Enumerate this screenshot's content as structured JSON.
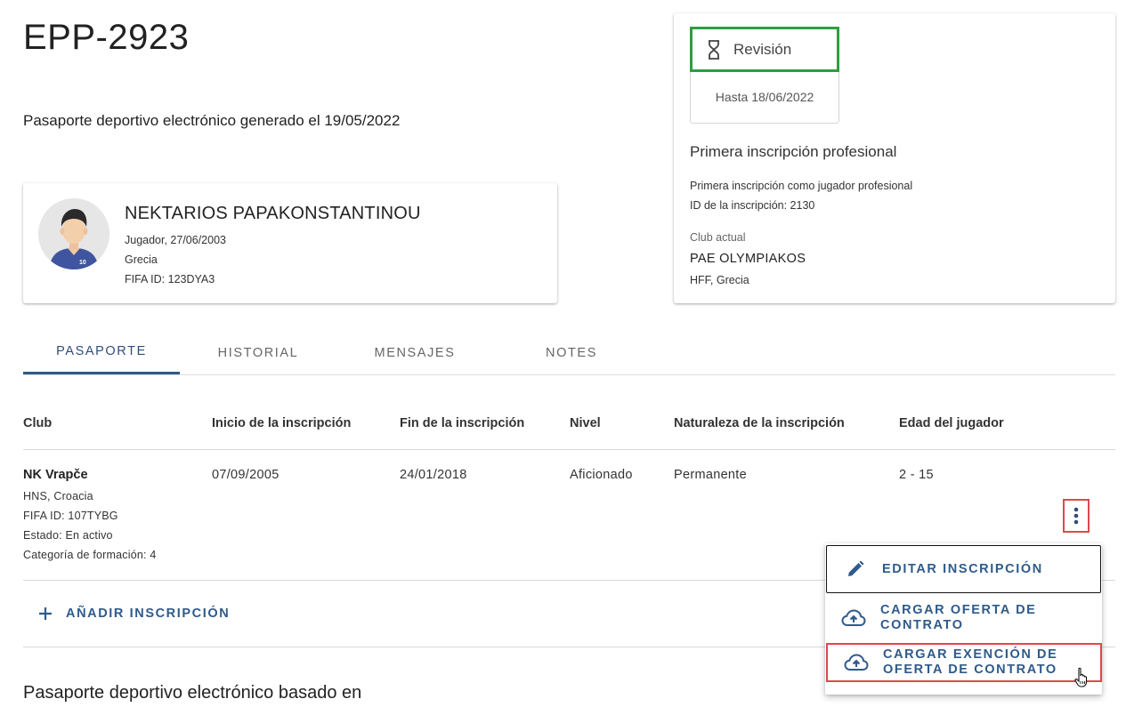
{
  "page": {
    "title": "EPP-2923",
    "subtitle": "Pasaporte deportivo electrónico generado el 19/05/2022"
  },
  "player": {
    "name": "NEKTARIOS PAPAKONSTANTINOU",
    "role_birth": "Jugador, 27/06/2003",
    "country": "Grecia",
    "fifa_id": "FIFA ID: 123DYA3",
    "jersey_number": "10"
  },
  "status": {
    "label": "Revisión",
    "until": "Hasta 18/06/2022",
    "accent_color": "#2e9e3e"
  },
  "registration": {
    "title": "Primera inscripción profesional",
    "description": "Primera inscripción como jugador profesional",
    "id": "ID de la inscripción: 2130",
    "current_club_label": "Club actual",
    "current_club_name": "PAE OLYMPIAKOS",
    "current_club_federation": "HFF, Grecia"
  },
  "tabs": [
    {
      "label": "PASAPORTE",
      "active": true
    },
    {
      "label": "HISTORIAL",
      "active": false
    },
    {
      "label": "MENSAJES",
      "active": false
    },
    {
      "label": "NOTES",
      "active": false
    }
  ],
  "table": {
    "headers": [
      "Club",
      "Inicio de la inscripción",
      "Fin de la inscripción",
      "Nivel",
      "Naturaleza de la inscripción",
      "Edad del jugador"
    ],
    "rows": [
      {
        "club_name": "NK Vrapče",
        "club_federation": "HNS, Croacia",
        "club_fifa_id": "FIFA ID: 107TYBG",
        "club_status": "Estado: En activo",
        "club_training_category": "Categoría de formación: 4",
        "start": "07/09/2005",
        "end": "24/01/2018",
        "level": "Aficionado",
        "nature": "Permanente",
        "age": "2 - 15"
      }
    ]
  },
  "actions": {
    "add_registration": "AÑADIR INSCRIPCIÓN",
    "more_icon": "more-vertical-icon"
  },
  "menu": {
    "items": [
      {
        "label": "EDITAR INSCRIPCIÓN",
        "icon": "pencil-icon"
      },
      {
        "label": "CARGAR OFERTA DE CONTRATO",
        "icon": "cloud-upload-icon"
      },
      {
        "label": "CARGAR EXENCIÓN DE OFERTA DE CONTRATO",
        "icon": "cloud-upload-icon"
      }
    ]
  },
  "section": {
    "title": "Pasaporte deportivo electrónico basado en"
  },
  "colors": {
    "accent": "#2f5a8a",
    "highlight": "#e0474c"
  }
}
